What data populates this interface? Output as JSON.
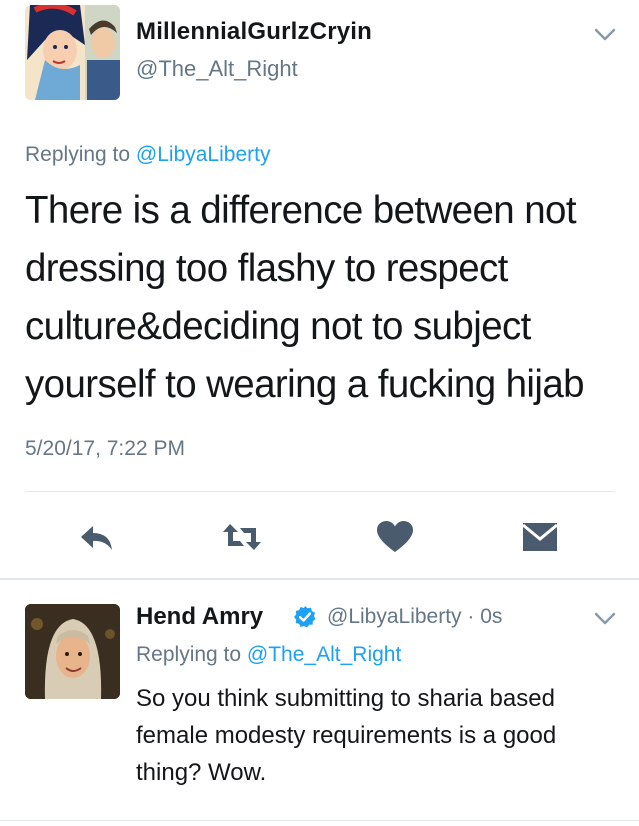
{
  "main_tweet": {
    "display_name": "MillennialGurlzCryin",
    "handle": "@The_Alt_Right",
    "replying_prefix": "Replying to ",
    "replying_mention": "@LibyaLiberty",
    "text": "There is a difference between not dressing too flashy to respect culture&deciding not to  subject yourself to wearing a fucking hijab",
    "timestamp": "5/20/17, 7:22 PM",
    "actions": [
      "reply-icon",
      "retweet-icon",
      "like-icon",
      "direct-message-icon"
    ],
    "menu_icon": "chevron-down-icon"
  },
  "reply_tweet": {
    "display_name": "Hend Amry",
    "verified": true,
    "handle_time": "@LibyaLiberty · 0s",
    "replying_prefix": "Replying to ",
    "replying_mention": "@The_Alt_Right",
    "text": "So you think submitting to sharia based female modesty requirements is a good thing? Wow.",
    "menu_icon": "chevron-down-icon"
  },
  "colors": {
    "text": "#14171a",
    "secondary": "#657786",
    "accent": "#1da1f2",
    "icon": "#4a5b6e",
    "divider": "#e1e8ed"
  }
}
